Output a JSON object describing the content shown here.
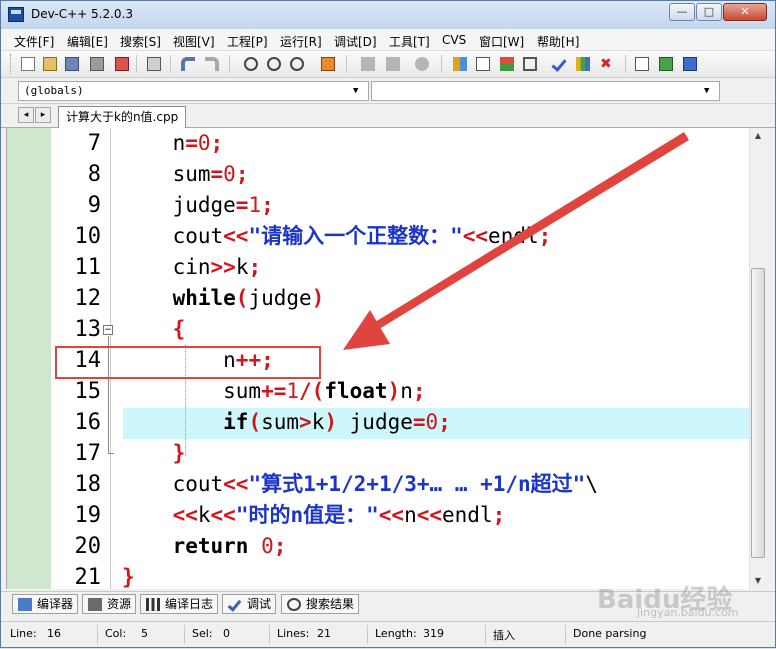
{
  "window": {
    "title": "Dev-C++ 5.2.0.3",
    "controls": {
      "minimize": "—",
      "maximize": "□",
      "close": "✕"
    }
  },
  "menu": [
    "文件[F]",
    "编辑[E]",
    "搜索[S]",
    "视图[V]",
    "工程[P]",
    "运行[R]",
    "调试[D]",
    "工具[T]",
    "CVS",
    "窗口[W]",
    "帮助[H]"
  ],
  "combos": {
    "scope": "(globals)",
    "member": ""
  },
  "tabs": {
    "file": "计算大于k的n值.cpp",
    "prev": "◂",
    "next": "▸"
  },
  "code_lines": [
    {
      "no": "7",
      "html": "    n<span class=\"op\">=</span><span class=\"num\">0</span><span class=\"op\">;</span>"
    },
    {
      "no": "8",
      "html": "    sum<span class=\"op\">=</span><span class=\"num\">0</span><span class=\"op\">;</span>"
    },
    {
      "no": "9",
      "html": "    judge<span class=\"op\">=</span><span class=\"num\">1</span><span class=\"op\">;</span>"
    },
    {
      "no": "10",
      "html": "    cout<span class=\"op\">&lt;&lt;</span><span class=\"str\">\"请输入一个正整数：\"</span><span class=\"op\">&lt;&lt;</span>endl<span class=\"op\">;</span>"
    },
    {
      "no": "11",
      "html": "    cin<span class=\"op\">&gt;&gt;</span>k<span class=\"op\">;</span>"
    },
    {
      "no": "12",
      "html": "    <span class=\"kw\">while</span><span class=\"op\">(</span>judge<span class=\"op\">)</span>"
    },
    {
      "no": "13",
      "html": "    <span class=\"op\">{</span>"
    },
    {
      "no": "14",
      "html": "        n<span class=\"op\">++;</span>"
    },
    {
      "no": "15",
      "html": "        sum<span class=\"op\">+=</span><span class=\"num\">1</span><span class=\"op\">/(</span><span class=\"kw\">float</span><span class=\"op\">)</span>n<span class=\"op\">;</span>"
    },
    {
      "no": "16",
      "html": "        <span class=\"kw\">if</span><span class=\"op\">(</span>sum<span class=\"op\">&gt;</span>k<span class=\"op\">)</span> judge<span class=\"op\">=</span><span class=\"num\">0</span><span class=\"op\">;</span>"
    },
    {
      "no": "17",
      "html": "    <span class=\"op\">}</span>"
    },
    {
      "no": "18",
      "html": "    cout<span class=\"op\">&lt;&lt;</span><span class=\"str\">\"算式1+1/2+1/3+… … +1/n超过\"</span>\\"
    },
    {
      "no": "19",
      "html": "    <span class=\"op\">&lt;&lt;</span>k<span class=\"op\">&lt;&lt;</span><span class=\"str\">\"时的n值是：\"</span><span class=\"op\">&lt;&lt;</span>n<span class=\"op\">&lt;&lt;</span>endl<span class=\"op\">;</span>"
    },
    {
      "no": "20",
      "html": "    <span class=\"kw\">return</span> <span class=\"num\">0</span><span class=\"op\">;</span>"
    },
    {
      "no": "21",
      "html": "<span class=\"op\">}</span>"
    }
  ],
  "bottom_tabs": [
    {
      "label": "编译器",
      "icon": "compiler-icon"
    },
    {
      "label": "资源",
      "icon": "resources-icon"
    },
    {
      "label": "编译日志",
      "icon": "compile-log-icon"
    },
    {
      "label": "调试",
      "icon": "debug-icon"
    },
    {
      "label": "搜索结果",
      "icon": "search-results-icon"
    }
  ],
  "status": {
    "line_label": "Line:",
    "line": "16",
    "col_label": "Col:",
    "col": "5",
    "sel_label": "Sel:",
    "sel": "0",
    "lines_label": "Lines:",
    "lines": "21",
    "length_label": "Length:",
    "length": "319",
    "mode": "插入",
    "message": "Done parsing"
  },
  "watermark": {
    "main": "Baidu经验",
    "sub": "jingyan.baidu.com"
  },
  "colors": {
    "operator": "#d3151b",
    "string": "#1b35c8",
    "current_line": "#cdf7fb",
    "annotation": "#e0443f",
    "gutter": "#cfe7cf"
  }
}
